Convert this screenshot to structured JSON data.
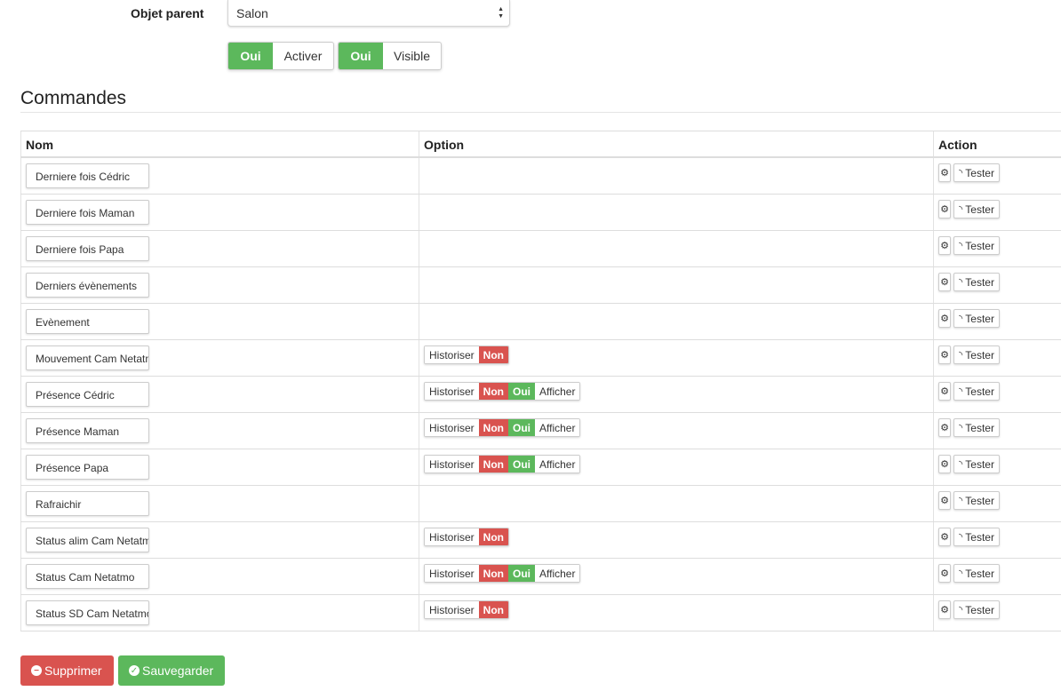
{
  "header": {
    "parent_label": "Objet parent",
    "parent_value": "Salon",
    "activer": {
      "state": "Oui",
      "label": "Activer"
    },
    "visible": {
      "state": "Oui",
      "label": "Visible"
    }
  },
  "section_title": "Commandes",
  "table": {
    "columns": [
      "Nom",
      "Option",
      "Action"
    ],
    "rows": [
      {
        "name": "Derniere fois Cédric",
        "option": null
      },
      {
        "name": "Derniere fois Maman",
        "option": null
      },
      {
        "name": "Derniere fois Papa",
        "option": null
      },
      {
        "name": "Derniers évènements",
        "option": null
      },
      {
        "name": "Evènement",
        "option": null
      },
      {
        "name": "Mouvement Cam Netatmo",
        "option": "hist"
      },
      {
        "name": "Présence Cédric",
        "option": "full"
      },
      {
        "name": "Présence Maman",
        "option": "full"
      },
      {
        "name": "Présence Papa",
        "option": "full"
      },
      {
        "name": "Rafraichir",
        "option": null
      },
      {
        "name": "Status alim Cam Netatmo",
        "option": "hist"
      },
      {
        "name": "Status Cam Netatmo",
        "option": "full"
      },
      {
        "name": "Status SD Cam Netatmo",
        "option": "hist"
      }
    ],
    "option_labels": {
      "historiser": "Historiser",
      "non": "Non",
      "oui": "Oui",
      "afficher": "Afficher"
    },
    "action_labels": {
      "config_icon": "gears-icon",
      "test_icon": "rss-icon",
      "test": "Tester"
    }
  },
  "footer": {
    "delete": "Supprimer",
    "save": "Sauvegarder"
  },
  "colors": {
    "green": "#5cb85c",
    "red": "#d9534f"
  }
}
